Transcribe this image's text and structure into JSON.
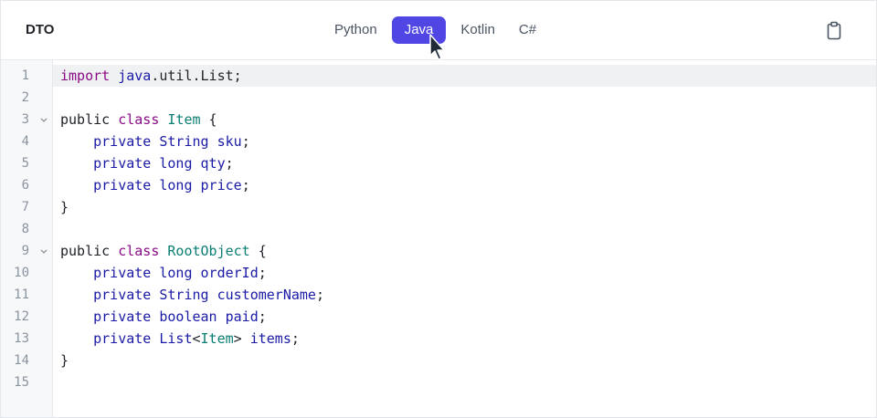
{
  "header": {
    "title": "DTO",
    "tabs": [
      {
        "label": "Python",
        "active": false
      },
      {
        "label": "Java",
        "active": true
      },
      {
        "label": "Kotlin",
        "active": false
      },
      {
        "label": "C#",
        "active": false
      }
    ],
    "copy_icon": "clipboard-icon"
  },
  "editor": {
    "current_line": 1,
    "lines": [
      {
        "num": "1",
        "tokens": [
          {
            "t": "import",
            "c": "kw"
          },
          {
            "t": " ",
            "c": ""
          },
          {
            "t": "java",
            "c": "type"
          },
          {
            "t": ".util.List;",
            "c": ""
          }
        ]
      },
      {
        "num": "2",
        "tokens": []
      },
      {
        "num": "3",
        "fold": true,
        "tokens": [
          {
            "t": "public ",
            "c": ""
          },
          {
            "t": "class",
            "c": "kw"
          },
          {
            "t": " ",
            "c": ""
          },
          {
            "t": "Item",
            "c": "cls"
          },
          {
            "t": " {",
            "c": ""
          }
        ]
      },
      {
        "num": "4",
        "tokens": [
          {
            "t": "    ",
            "c": ""
          },
          {
            "t": "private String sku",
            "c": "type"
          },
          {
            "t": ";",
            "c": ""
          }
        ]
      },
      {
        "num": "5",
        "tokens": [
          {
            "t": "    ",
            "c": ""
          },
          {
            "t": "private long qty",
            "c": "type"
          },
          {
            "t": ";",
            "c": ""
          }
        ]
      },
      {
        "num": "6",
        "tokens": [
          {
            "t": "    ",
            "c": ""
          },
          {
            "t": "private long price",
            "c": "type"
          },
          {
            "t": ";",
            "c": ""
          }
        ]
      },
      {
        "num": "7",
        "tokens": [
          {
            "t": "}",
            "c": ""
          }
        ]
      },
      {
        "num": "8",
        "tokens": []
      },
      {
        "num": "9",
        "fold": true,
        "tokens": [
          {
            "t": "public ",
            "c": ""
          },
          {
            "t": "class",
            "c": "kw"
          },
          {
            "t": " ",
            "c": ""
          },
          {
            "t": "RootObject",
            "c": "cls"
          },
          {
            "t": " {",
            "c": ""
          }
        ]
      },
      {
        "num": "10",
        "tokens": [
          {
            "t": "    ",
            "c": ""
          },
          {
            "t": "private long orderId",
            "c": "type"
          },
          {
            "t": ";",
            "c": ""
          }
        ]
      },
      {
        "num": "11",
        "tokens": [
          {
            "t": "    ",
            "c": ""
          },
          {
            "t": "private String customerName",
            "c": "type"
          },
          {
            "t": ";",
            "c": ""
          }
        ]
      },
      {
        "num": "12",
        "tokens": [
          {
            "t": "    ",
            "c": ""
          },
          {
            "t": "private boolean paid",
            "c": "type"
          },
          {
            "t": ";",
            "c": ""
          }
        ]
      },
      {
        "num": "13",
        "tokens": [
          {
            "t": "    ",
            "c": ""
          },
          {
            "t": "private List",
            "c": "type"
          },
          {
            "t": "<",
            "c": ""
          },
          {
            "t": "Item",
            "c": "cls"
          },
          {
            "t": ">",
            "c": ""
          },
          {
            "t": " items",
            "c": "type"
          },
          {
            "t": ";",
            "c": ""
          }
        ]
      },
      {
        "num": "14",
        "tokens": [
          {
            "t": "}",
            "c": ""
          }
        ]
      },
      {
        "num": "15",
        "tokens": []
      }
    ]
  },
  "colors": {
    "accent": "#5046e4",
    "keyword": "#8a0c85",
    "type": "#1a1aa6",
    "class": "#0b7e73"
  }
}
